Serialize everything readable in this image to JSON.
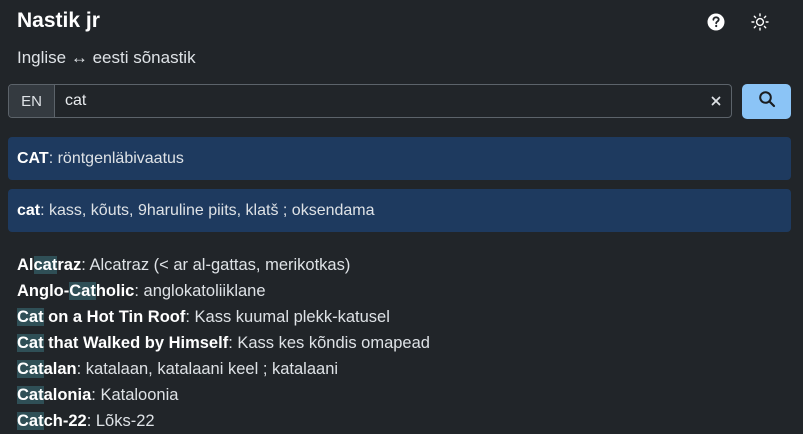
{
  "header": {
    "title": "Nastik jr",
    "subtitle": "Inglise ↔ eesti sõnastik",
    "help_icon": "question-circle-icon",
    "theme_icon": "sun-icon"
  },
  "search": {
    "language": "EN",
    "query": "cat",
    "clear_icon": "close-icon",
    "search_icon": "search-icon"
  },
  "colors": {
    "background": "#212529",
    "card": "#1e3a5f",
    "search_button": "#8bc4f6",
    "highlight": "#2f4f56"
  },
  "exact_matches": [
    {
      "headword": "CAT",
      "translation": ": röntgenläbivaatus"
    },
    {
      "headword": "cat",
      "translation": ": kass, kõuts, 9haruline piits, klatš ; oksendama"
    }
  ],
  "results": [
    {
      "pre": "Al",
      "hl": "cat",
      "post": "raz",
      "translation": ": Alcatraz (< ar al-gattas, merikotkas)"
    },
    {
      "pre": "Anglo-",
      "hl": "Cat",
      "post": "holic",
      "translation": ": anglokatoliiklane"
    },
    {
      "pre": "",
      "hl": "Cat",
      "post": " on a Hot Tin Roof",
      "translation": ": Kass kuumal plekk-katusel"
    },
    {
      "pre": "",
      "hl": "Cat",
      "post": " that Walked by Himself",
      "translation": ": Kass kes kõndis omapead"
    },
    {
      "pre": "",
      "hl": "Cat",
      "post": "alan",
      "translation": ": katalaan, katalaani keel ; katalaani"
    },
    {
      "pre": "",
      "hl": "Cat",
      "post": "alonia",
      "translation": ": Kataloonia"
    },
    {
      "pre": "",
      "hl": "Cat",
      "post": "ch-22",
      "translation": ": Lõks-22"
    }
  ]
}
